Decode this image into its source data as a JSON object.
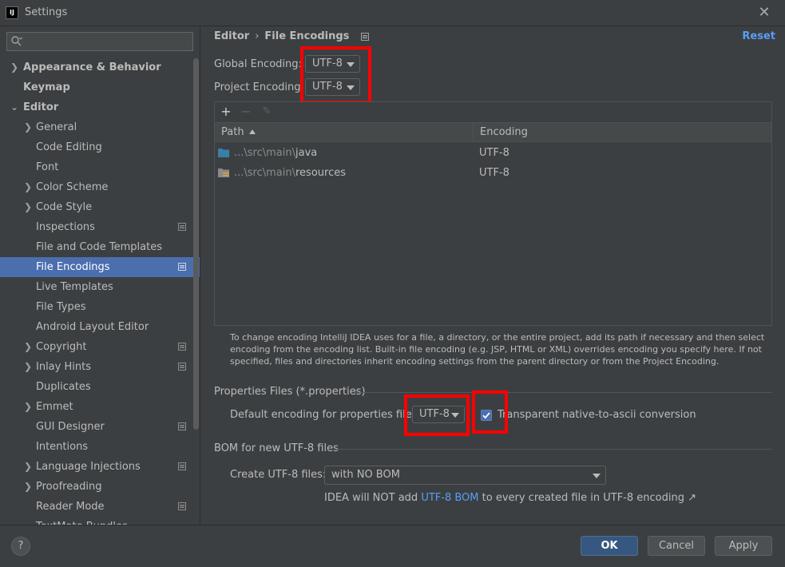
{
  "window": {
    "title": "Settings",
    "app_icon_label": "IJ"
  },
  "search": {
    "placeholder": "",
    "value": ""
  },
  "sidebar": {
    "items": [
      {
        "label": "Appearance & Behavior"
      },
      {
        "label": "Keymap"
      },
      {
        "label": "Editor"
      },
      {
        "label": "General"
      },
      {
        "label": "Code Editing"
      },
      {
        "label": "Font"
      },
      {
        "label": "Color Scheme"
      },
      {
        "label": "Code Style"
      },
      {
        "label": "Inspections"
      },
      {
        "label": "File and Code Templates"
      },
      {
        "label": "File Encodings"
      },
      {
        "label": "Live Templates"
      },
      {
        "label": "File Types"
      },
      {
        "label": "Android Layout Editor"
      },
      {
        "label": "Copyright"
      },
      {
        "label": "Inlay Hints"
      },
      {
        "label": "Duplicates"
      },
      {
        "label": "Emmet"
      },
      {
        "label": "GUI Designer"
      },
      {
        "label": "Intentions"
      },
      {
        "label": "Language Injections"
      },
      {
        "label": "Proofreading"
      },
      {
        "label": "Reader Mode"
      },
      {
        "label": "TextMate Bundles"
      }
    ],
    "selected": "File Encodings"
  },
  "breadcrumb": {
    "parent": "Editor",
    "separator": "›",
    "current": "File Encodings"
  },
  "reset_label": "Reset",
  "global_encoding": {
    "label": "Global Encoding:",
    "value": "UTF-8"
  },
  "project_encoding": {
    "label": "Project Encoding:",
    "value": "UTF-8"
  },
  "table": {
    "toolbar": {
      "add": "+",
      "remove": "−",
      "edit": "✎"
    },
    "columns": {
      "path": "Path",
      "encoding": "Encoding"
    },
    "rows": [
      {
        "path_prefix": "...\\src\\main\\",
        "path_name": "java",
        "encoding": "UTF-8",
        "icon": "source-folder-icon"
      },
      {
        "path_prefix": "...\\src\\main\\",
        "path_name": "resources",
        "encoding": "UTF-8",
        "icon": "resources-folder-icon"
      }
    ]
  },
  "help_text": "To change encoding IntelliJ IDEA uses for a file, a directory, or the entire project, add its path if necessary and then select encoding from the encoding list. Built-in file encoding (e.g. JSP, HTML or XML) overrides encoding you specify here. If not specified, files and directories inherit encoding settings from the parent directory or from the Project Encoding.",
  "properties": {
    "section_title": "Properties Files (*.properties)",
    "default_label": "Default encoding for properties files:",
    "default_value": "UTF-8",
    "transparent_checked": true,
    "transparent_label": "Transparent native-to-ascii conversion"
  },
  "bom": {
    "section_title": "BOM for new UTF-8 files",
    "create_label": "Create UTF-8 files:",
    "create_value": "with NO BOM",
    "info_prefix": "IDEA will NOT add",
    "info_link": "UTF-8 BOM",
    "info_suffix": "to every created file in UTF-8 encoding ↗"
  },
  "buttons": {
    "help": "?",
    "ok": "OK",
    "cancel": "Cancel",
    "apply": "Apply"
  },
  "colors": {
    "accent": "#4b6eaf",
    "link": "#589df6",
    "highlight_box": "#ff0000",
    "background": "#3c3f41"
  }
}
